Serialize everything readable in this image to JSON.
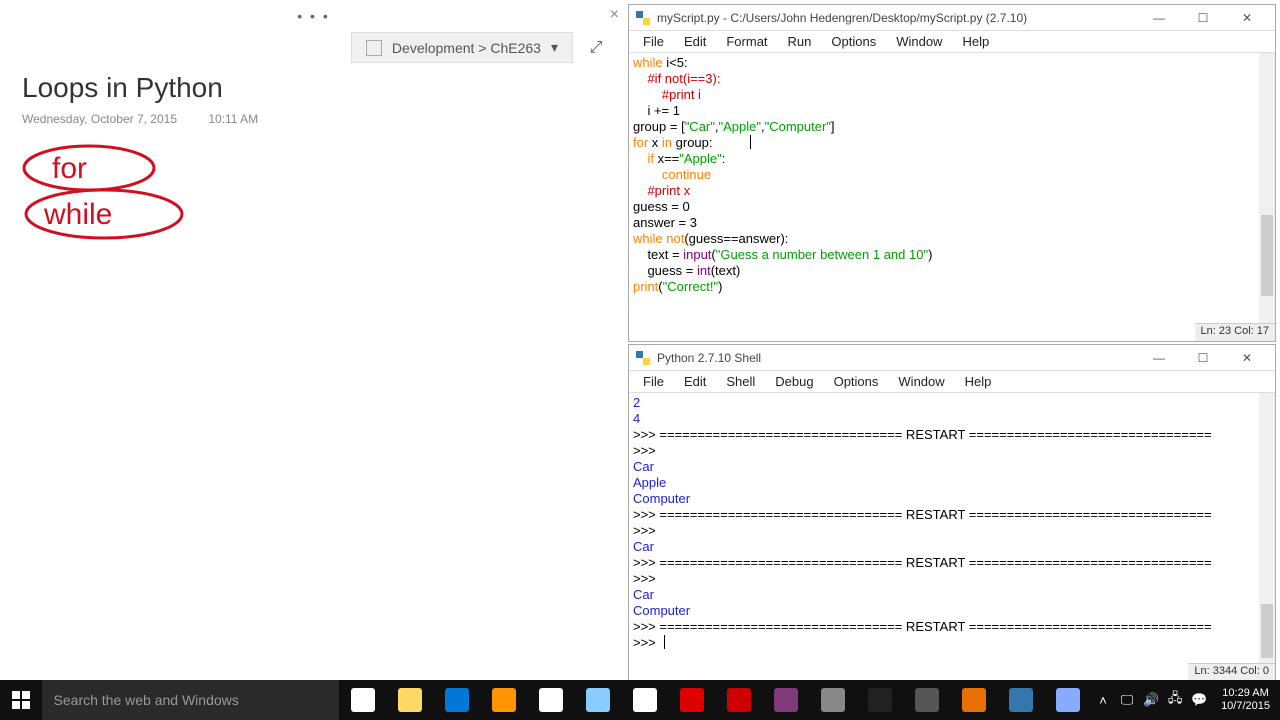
{
  "onenote": {
    "title": "Loops in Python",
    "date": "Wednesday, October 7, 2015",
    "time": "10:11 AM",
    "breadcrumb": "Development > ChE263",
    "ink_words": [
      "for",
      "while"
    ]
  },
  "editor": {
    "title": "myScript.py - C:/Users/John Hedengren/Desktop/myScript.py (2.7.10)",
    "menus": [
      "File",
      "Edit",
      "Format",
      "Run",
      "Options",
      "Window",
      "Help"
    ],
    "status": "Ln: 23 Col: 17",
    "caret_line": 5,
    "caret_col": 15,
    "code": [
      [
        [
          "kw",
          "while"
        ],
        [
          "",
          " i<5:"
        ]
      ],
      [
        [
          "",
          "    "
        ],
        [
          "com",
          "#if not(i==3):"
        ]
      ],
      [
        [
          "",
          "        "
        ],
        [
          "com",
          "#print i"
        ]
      ],
      [
        [
          "",
          "    i += 1"
        ]
      ],
      [
        [
          "",
          ""
        ]
      ],
      [
        [
          "",
          "group = ["
        ],
        [
          "str",
          "\"Car\""
        ],
        [
          "",
          ","
        ],
        [
          "str",
          "\"Apple\""
        ],
        [
          "",
          ","
        ],
        [
          "str",
          "\"Computer\""
        ],
        [
          "",
          "]"
        ]
      ],
      [
        [
          "kw",
          "for"
        ],
        [
          "",
          " x "
        ],
        [
          "kw",
          "in"
        ],
        [
          "",
          " group:"
        ]
      ],
      [
        [
          "",
          "    "
        ],
        [
          "kw",
          "if"
        ],
        [
          "",
          " x=="
        ],
        [
          "str",
          "\"Apple\""
        ],
        [
          "",
          ":"
        ]
      ],
      [
        [
          "",
          "        "
        ],
        [
          "kw",
          "continue"
        ]
      ],
      [
        [
          "",
          "    "
        ],
        [
          "com",
          "#print x"
        ]
      ],
      [
        [
          "",
          ""
        ]
      ],
      [
        [
          "",
          "guess = 0"
        ]
      ],
      [
        [
          "",
          "answer = 3"
        ]
      ],
      [
        [
          "kw",
          "while"
        ],
        [
          "",
          " "
        ],
        [
          "kw",
          "not"
        ],
        [
          "",
          "(guess==answer):"
        ]
      ],
      [
        [
          "",
          "    text = "
        ],
        [
          "fn",
          "input"
        ],
        [
          "",
          "("
        ],
        [
          "str",
          "\"Guess a number between 1 and 10\""
        ],
        [
          "",
          ")"
        ]
      ],
      [
        [
          "",
          "    guess = "
        ],
        [
          "fn",
          "int"
        ],
        [
          "",
          "(text)"
        ]
      ],
      [
        [
          "kw",
          "print"
        ],
        [
          "",
          "("
        ],
        [
          "str",
          "\"Correct!\""
        ],
        [
          "",
          ")"
        ]
      ]
    ]
  },
  "shell": {
    "title": "Python 2.7.10 Shell",
    "menus": [
      "File",
      "Edit",
      "Shell",
      "Debug",
      "Options",
      "Window",
      "Help"
    ],
    "status": "Ln: 3344 Col: 0",
    "lines": [
      [
        [
          "out",
          "2"
        ]
      ],
      [
        [
          "out",
          "4"
        ]
      ],
      [
        [
          "",
          ">>> ================================ RESTART ================================"
        ]
      ],
      [
        [
          "",
          ">>> "
        ]
      ],
      [
        [
          "out",
          "Car"
        ]
      ],
      [
        [
          "out",
          "Apple"
        ]
      ],
      [
        [
          "out",
          "Computer"
        ]
      ],
      [
        [
          "",
          ">>> ================================ RESTART ================================"
        ]
      ],
      [
        [
          "",
          ">>> "
        ]
      ],
      [
        [
          "out",
          "Car"
        ]
      ],
      [
        [
          "",
          ">>> ================================ RESTART ================================"
        ]
      ],
      [
        [
          "",
          ">>> "
        ]
      ],
      [
        [
          "out",
          "Car"
        ]
      ],
      [
        [
          "out",
          "Computer"
        ]
      ],
      [
        [
          "",
          ">>> ================================ RESTART ================================"
        ]
      ],
      [
        [
          "",
          ">>> "
        ]
      ]
    ]
  },
  "taskbar": {
    "search_placeholder": "Search the web and Windows",
    "clock_time": "10:29 AM",
    "clock_date": "10/7/2015",
    "apps": [
      "task-view",
      "explorer",
      "edge",
      "firefox",
      "chrome",
      "contact",
      "store",
      "r",
      "snagit",
      "onenote",
      "x",
      "cmd",
      "y",
      "matlab",
      "idle",
      "notepad"
    ]
  },
  "colors": {
    "ink": "#d01020"
  }
}
